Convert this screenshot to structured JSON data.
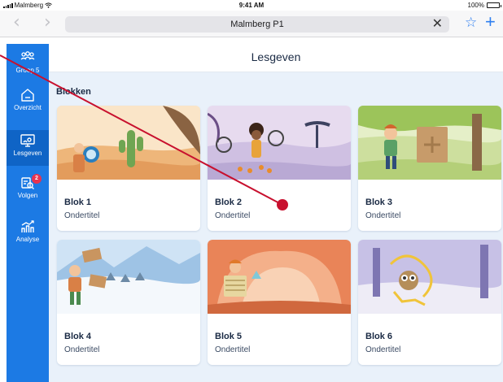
{
  "status_bar": {
    "carrier": "Malmberg",
    "time": "9:41 AM",
    "battery": "100%",
    "battery_level": 1.0
  },
  "browser": {
    "url": "Malmberg P1",
    "clear_icon": "close-icon",
    "bookmark_icon": "star-icon",
    "new_tab_icon": "plus-icon"
  },
  "sidebar": {
    "items": [
      {
        "label": "Groep 5",
        "icon": "group-icon"
      },
      {
        "label": "Overzicht",
        "icon": "home-icon"
      },
      {
        "label": "Lesgeven",
        "icon": "teach-screen-icon",
        "active": true
      },
      {
        "label": "Volgen",
        "icon": "follow-icon",
        "badge": "2"
      },
      {
        "label": "Analyse",
        "icon": "chart-icon"
      }
    ]
  },
  "header": {
    "title": "Lesgeven"
  },
  "section": {
    "label": "Blokken"
  },
  "cards": [
    {
      "title": "Blok 1",
      "subtitle": "Ondertitel"
    },
    {
      "title": "Blok 2",
      "subtitle": "Ondertitel"
    },
    {
      "title": "Blok 3",
      "subtitle": "Ondertitel"
    },
    {
      "title": "Blok 4",
      "subtitle": "Ondertitel"
    },
    {
      "title": "Blok 5",
      "subtitle": "Ondertitel"
    },
    {
      "title": "Blok 6",
      "subtitle": "Ondertitel"
    }
  ],
  "colors": {
    "sidebar": "#1c7ae4",
    "sidebar_active": "#0f64c6",
    "content_bg": "#e9f1fa",
    "badge": "#e8334f",
    "annotation": "#c8102e",
    "browser_accent": "#2f7ff0"
  }
}
